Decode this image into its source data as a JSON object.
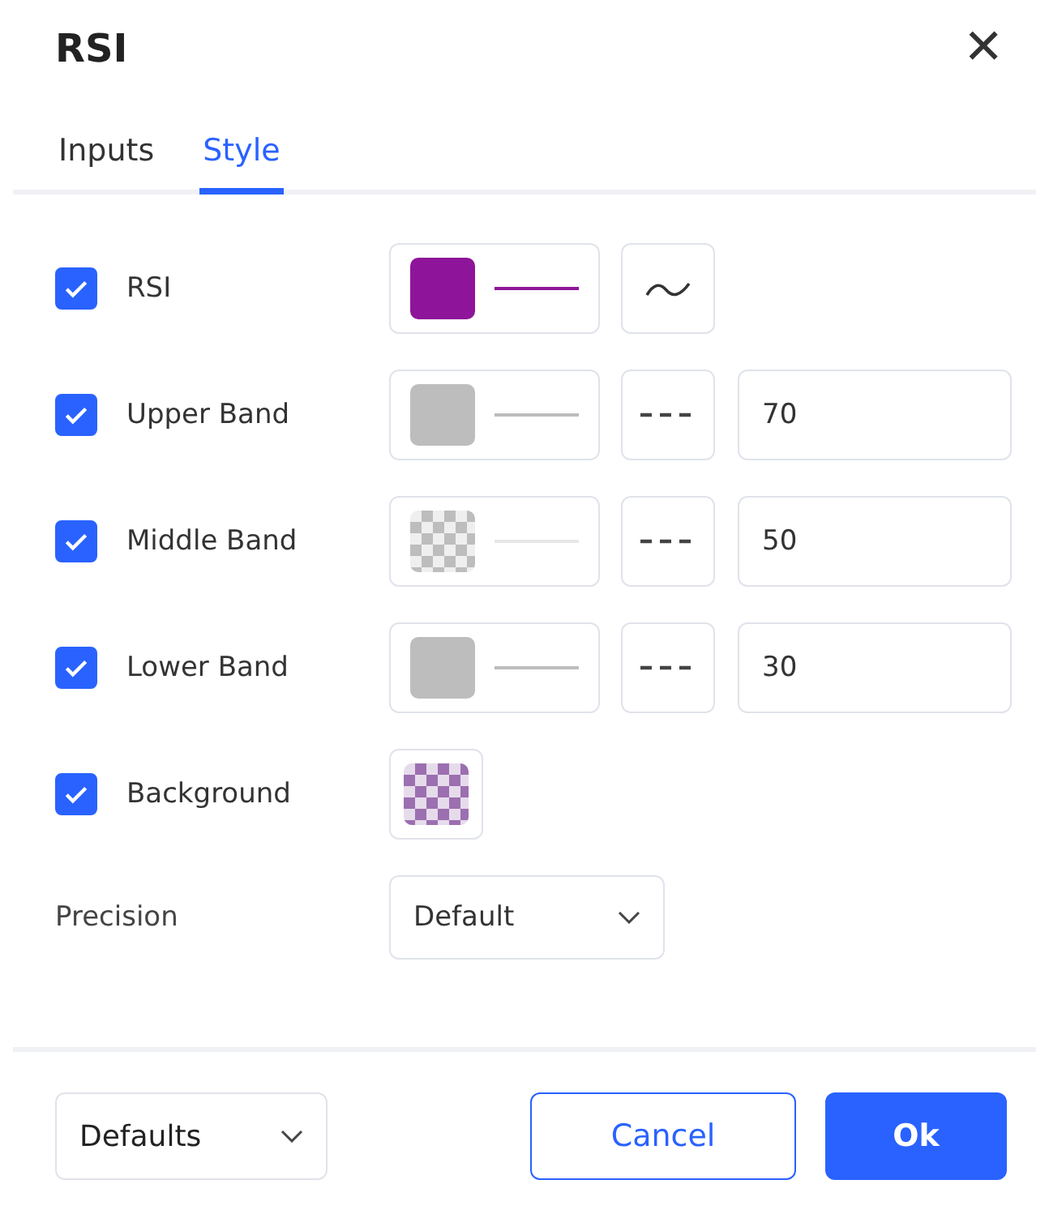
{
  "window": {
    "title": "RSI",
    "close": "✕"
  },
  "tabs": [
    {
      "label": "Inputs",
      "selected": false
    },
    {
      "label": "Style",
      "selected": true
    }
  ],
  "rows": [
    {
      "kind": "plot",
      "label": "RSI",
      "checked": true,
      "color": "#8e1599",
      "transparent": false
    },
    {
      "kind": "band",
      "label": "Upper Band",
      "checked": true,
      "color": "#bdbdbd",
      "transparent": false,
      "value": "70"
    },
    {
      "kind": "band",
      "label": "Middle Band",
      "checked": true,
      "color": "#bdbdbd",
      "transparent": true,
      "value": "50"
    },
    {
      "kind": "band",
      "label": "Lower Band",
      "checked": true,
      "color": "#bdbdbd",
      "transparent": false,
      "value": "30"
    },
    {
      "kind": "fill",
      "label": "Background",
      "checked": true,
      "color": "#9c6fb0",
      "transparent": true
    }
  ],
  "precision": {
    "label": "Precision",
    "value": "Default"
  },
  "footer": {
    "defaults": "Defaults",
    "cancel": "Cancel",
    "ok": "Ok"
  }
}
